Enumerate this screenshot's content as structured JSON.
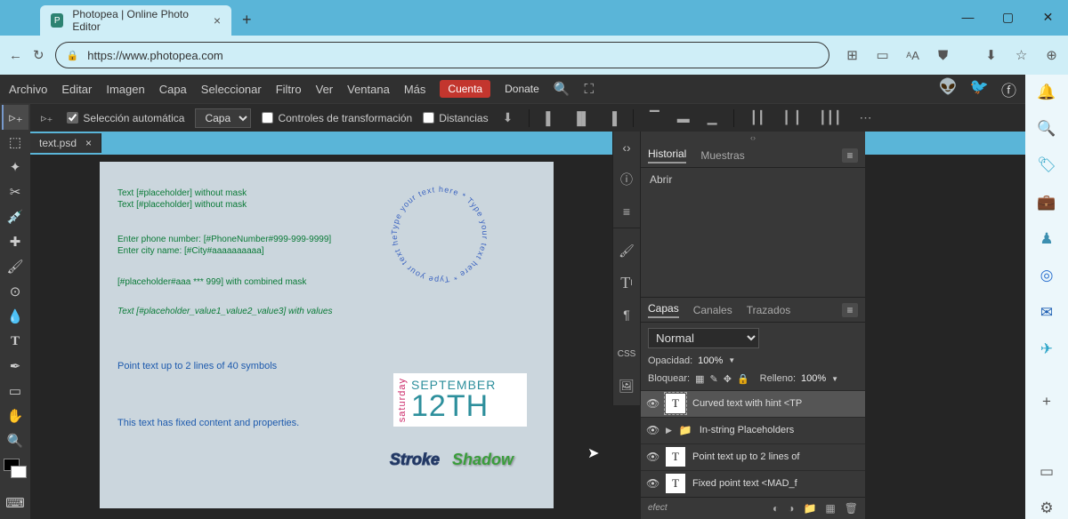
{
  "browser": {
    "tab_title": "Photopea | Online Photo Editor",
    "url": "https://www.photopea.com"
  },
  "menubar": {
    "items": [
      "Archivo",
      "Editar",
      "Imagen",
      "Capa",
      "Seleccionar",
      "Filtro",
      "Ver",
      "Ventana",
      "Más"
    ],
    "cuenta": "Cuenta",
    "donate": "Donate"
  },
  "optionsbar": {
    "auto_select": "Selección automática",
    "layer_select": "Capa",
    "transform_controls": "Controles de transformación",
    "distances": "Distancias"
  },
  "doc_tab": "text.psd",
  "canvas": {
    "line1": "Text [#placeholder] without mask",
    "line2": "Text [#placeholder] without mask",
    "line3": "Enter phone number: [#PhoneNumber#999-999-9999]",
    "line4": "Enter city name: [#City#aaaaaaaaaa]",
    "line5": "[#placeholder#aaa *** 999] with combined mask",
    "line6": "Text [#placeholder_value1_value2_value3] with values",
    "line7": "Point text up to 2 lines of 40 symbols",
    "line8": "This text has fixed content and properties.",
    "circle_text": "Type your text here * Type your text here * Type your text here *",
    "cal_saturday": "saturday",
    "cal_month": "SEPTEMBER",
    "cal_day": "12TH",
    "stroke": "Stroke",
    "shadow": "Shadow"
  },
  "history_panel": {
    "tab1": "Historial",
    "tab2": "Muestras",
    "entry": "Abrir"
  },
  "layers_panel": {
    "tab1": "Capas",
    "tab2": "Canales",
    "tab3": "Trazados",
    "blend_mode": "Normal",
    "opacity_label": "Opacidad:",
    "opacity_value": "100%",
    "lock_label": "Bloquear:",
    "fill_label": "Relleno:",
    "fill_value": "100%",
    "layers": [
      {
        "name": "Curved text with hint <TP",
        "type": "text",
        "selected": true
      },
      {
        "name": "In-string Placeholders",
        "type": "folder",
        "selected": false
      },
      {
        "name": "Point text up to 2 lines of",
        "type": "text",
        "selected": false
      },
      {
        "name": "Fixed point text <MAD_f",
        "type": "text",
        "selected": false
      }
    ],
    "foot": "efect"
  }
}
